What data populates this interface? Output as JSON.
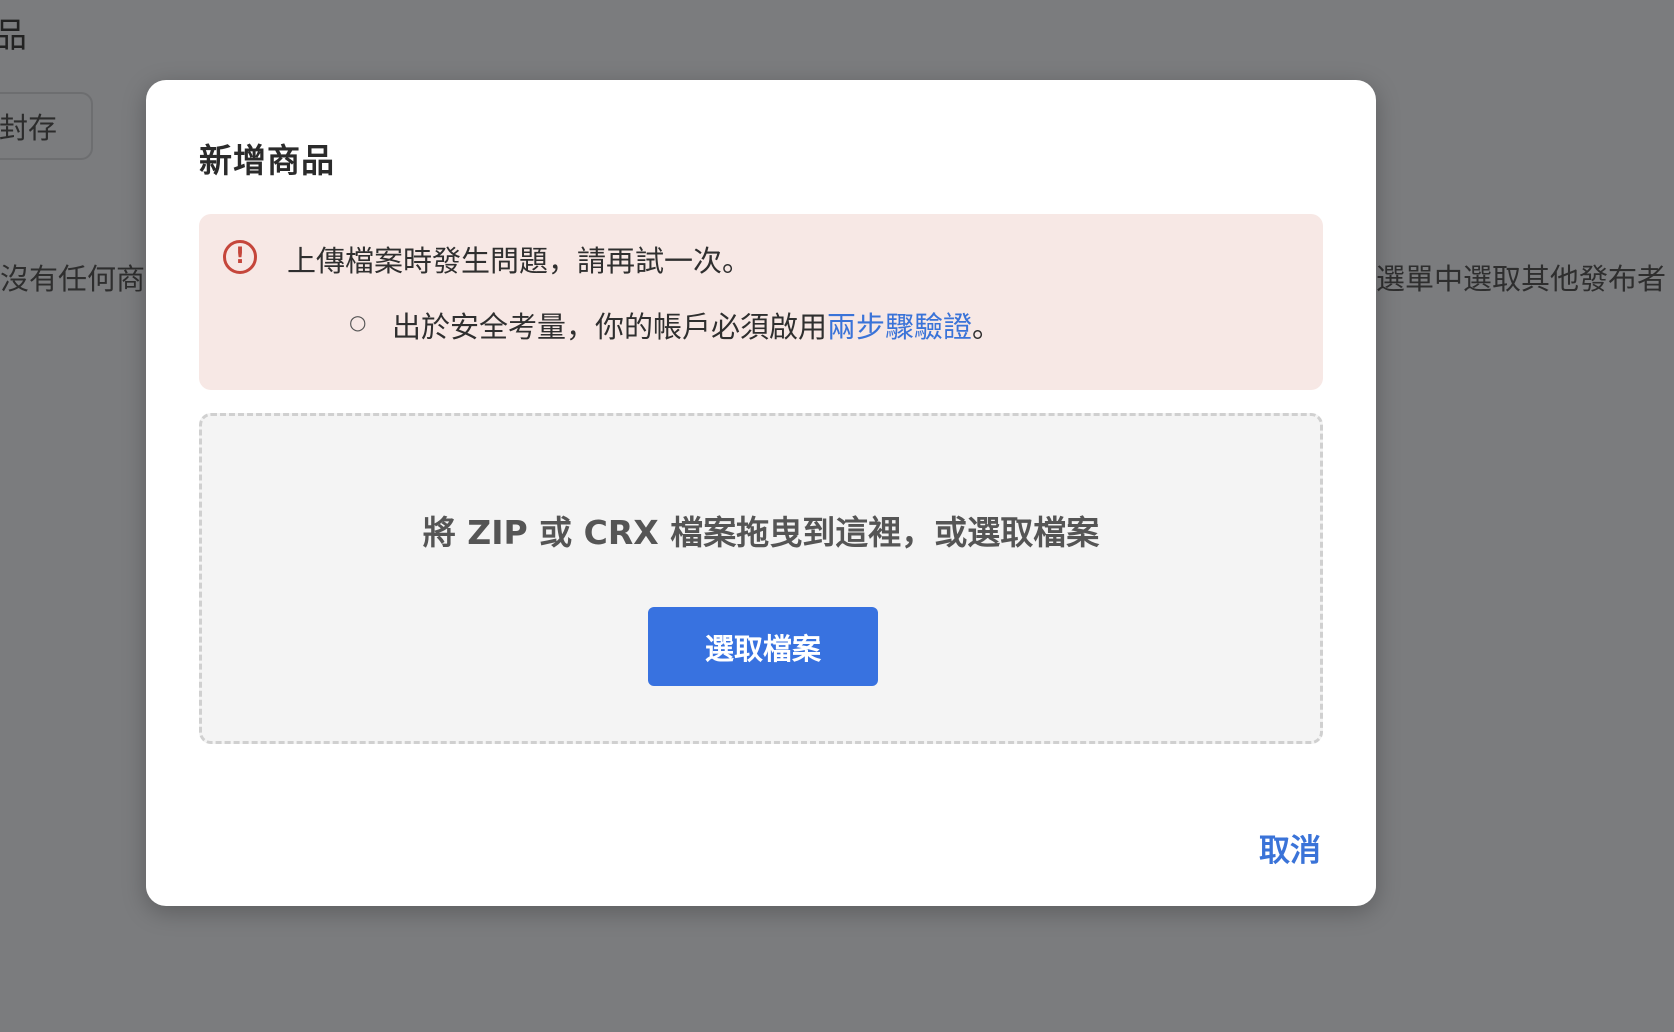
{
  "background": {
    "page_title": "品",
    "archive_button": "封存",
    "left_text": "沒有任何商",
    "right_text": "選單中選取其他發布者"
  },
  "modal": {
    "title": "新增商品",
    "error": {
      "message": "上傳檔案時發生問題，請再試一次。",
      "bullet": "○",
      "detail_prefix": "出於安全考量，你的帳戶必須啟用",
      "detail_link": "兩步驟驗證",
      "detail_suffix": "。",
      "icon": "!"
    },
    "drop_zone": {
      "text": "將 ZIP 或 CRX 檔案拖曳到這裡，或選取檔案",
      "button_label": "選取檔案"
    },
    "cancel_label": "取消"
  },
  "colors": {
    "accent": "#3872e0",
    "error": "#c5463b",
    "error_bg": "#f7e8e5"
  }
}
